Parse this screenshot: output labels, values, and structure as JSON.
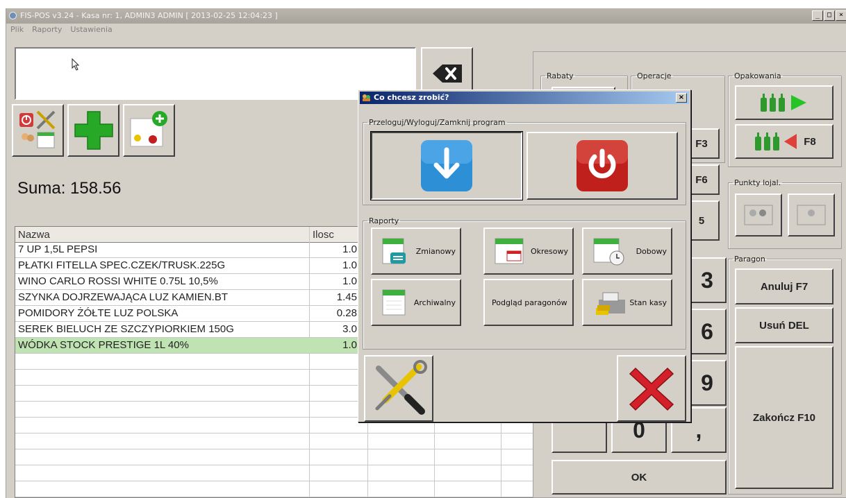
{
  "window": {
    "title": "FIS-POS v3.24 - Kasa nr: 1, ADMIN3 ADMIN [ 2013-02-25 12:04:23 ]",
    "controls": [
      "_",
      "□",
      "×"
    ]
  },
  "menu": [
    "Plik",
    "Raporty",
    "Ustawienia"
  ],
  "summary": {
    "label": "Suma: 158.56"
  },
  "grid": {
    "headers": [
      "Nazwa",
      "Ilosc"
    ],
    "rows": [
      {
        "name": "7 UP 1,5L PEPSI",
        "qty": "1.0"
      },
      {
        "name": "PŁATKI FITELLA SPEC.CZEK/TRUSK.225G",
        "qty": "1.0"
      },
      {
        "name": "WINO CARLO ROSSI WHITE 0.75L 10,5%",
        "qty": "1.0"
      },
      {
        "name": "SZYNKA DOJRZEWAJĄCA LUZ KAMIEN.BT",
        "qty": "1.45"
      },
      {
        "name": "POMIDORY ŻÓŁTE LUZ POLSKA",
        "qty": "0.28"
      },
      {
        "name": "SEREK BIELUCH ZE SZCZYPIORKIEM 150G",
        "qty": "3.0"
      },
      {
        "name": "WÓDKA STOCK PRESTIGE 1L 40%",
        "qty": "1.0"
      }
    ],
    "selected_row": 6
  },
  "right_panel": {
    "groups": {
      "rabaty": "Rabaty",
      "operacje": "Operacje",
      "opakowania": "Opakowania",
      "punkty": "Punkty lojal.",
      "paragon": "Paragon"
    },
    "keys": {
      "f3": "F3",
      "f6": "F6",
      "f5_partial": "5",
      "f8": "F8",
      "num_3": "3",
      "num_6": "6",
      "num_9": "9",
      "num_0": "0",
      "comma": ",",
      "ok": "OK"
    },
    "paragon_buttons": {
      "anuluj": "Anuluj F7",
      "usun": "Usuń DEL",
      "zakoncz": "Zakończ F10"
    }
  },
  "dialog": {
    "title": "Co chcesz zrobić?",
    "close": "×",
    "group1_label": "Przeloguj/Wyloguj/Zamknij program",
    "group2_label": "Raporty",
    "reports": [
      {
        "label": "Zmianowy",
        "icon": "calendar-arrows-icon"
      },
      {
        "label": "Okresowy",
        "icon": "calendar-range-icon"
      },
      {
        "label": "Dobowy",
        "icon": "calendar-clock-icon"
      },
      {
        "label": "Archiwalny",
        "icon": "calendar-icon"
      },
      {
        "label": "Podgląd paragonów",
        "icon": ""
      },
      {
        "label": "Stan kasy",
        "icon": "cash-register-icon"
      }
    ]
  },
  "colors": {
    "window_bg": "#d4d0c8",
    "selected_row": "#bfe3b2",
    "dialog_title": "#0a246a",
    "logout_blue": "#2d8fd6",
    "exit_red": "#c0201b",
    "green_icon": "#27a827"
  }
}
